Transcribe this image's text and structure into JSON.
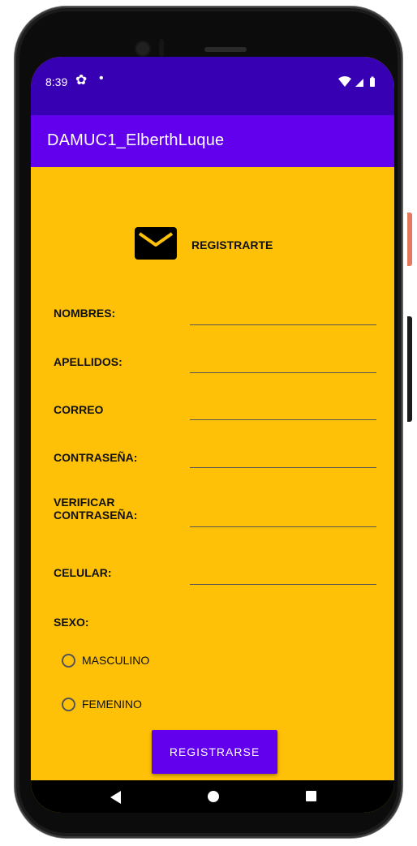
{
  "status_bar": {
    "time": "8:39",
    "icons": [
      "settings-icon",
      "notification-dot-icon",
      "wifi-icon",
      "signal-icon",
      "battery-icon"
    ]
  },
  "app_bar": {
    "title": "DAMUC1_ElberthLuque"
  },
  "form": {
    "heading": "REGISTRARTE",
    "fields": [
      {
        "name": "nombres",
        "label": "NOMBRES:",
        "value": ""
      },
      {
        "name": "apellidos",
        "label": "APELLIDOS:",
        "value": ""
      },
      {
        "name": "correo",
        "label": "CORREO",
        "value": ""
      },
      {
        "name": "contrasena",
        "label": "CONTRASEÑA:",
        "value": ""
      },
      {
        "name": "verificar",
        "label": "VERIFICAR\nCONTRASEÑA:",
        "value": ""
      },
      {
        "name": "celular",
        "label": "CELULAR:",
        "value": ""
      }
    ],
    "sexo_label": "SEXO:",
    "sexo_options": [
      {
        "label": "MASCULINO",
        "checked": false
      },
      {
        "label": "FEMENINO",
        "checked": false
      }
    ],
    "submit_label": "REGISTRARSE"
  },
  "colors": {
    "status_bar": "#3700b3",
    "app_bar": "#6200ee",
    "background": "#ffc107",
    "button": "#6200ee"
  }
}
